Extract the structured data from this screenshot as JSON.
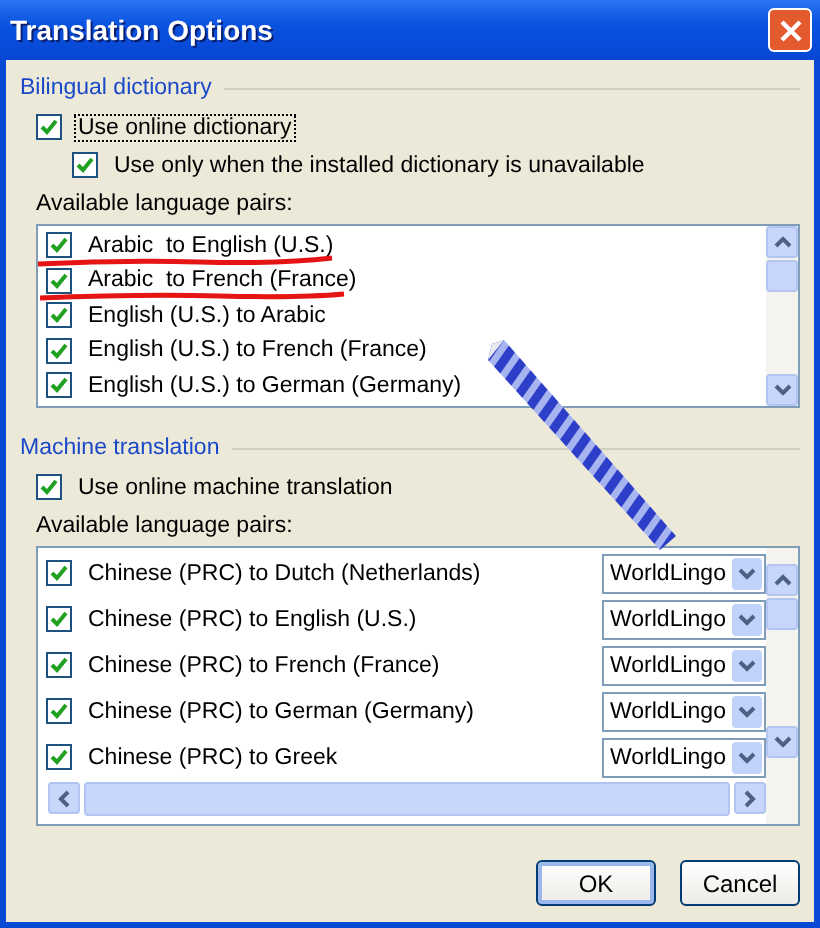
{
  "window": {
    "title": "Translation Options"
  },
  "bilingual_dictionary": {
    "heading": "Bilingual dictionary",
    "options": [
      {
        "label": "Use online dictionary",
        "checked": true,
        "focused": true,
        "indented": false
      },
      {
        "label": "Use only when the installed dictionary is unavailable",
        "checked": true,
        "focused": false,
        "indented": true
      }
    ],
    "pairs_label": "Available language pairs:",
    "pairs": [
      {
        "label": "Arabic  to English (U.S.)",
        "checked": true
      },
      {
        "label": "Arabic  to French (France)",
        "checked": true
      },
      {
        "label": "English (U.S.) to Arabic",
        "checked": true
      },
      {
        "label": "English (U.S.) to French (France)",
        "checked": true
      },
      {
        "label": "English (U.S.) to German (Germany)",
        "checked": true
      }
    ]
  },
  "machine_translation": {
    "heading": "Machine translation",
    "option": {
      "label": "Use online machine translation",
      "checked": true
    },
    "pairs_label": "Available language pairs:",
    "pairs": [
      {
        "label": "Chinese (PRC) to Dutch (Netherlands)",
        "checked": true,
        "service": "WorldLingo"
      },
      {
        "label": "Chinese (PRC) to English (U.S.)",
        "checked": true,
        "service": "WorldLingo"
      },
      {
        "label": "Chinese (PRC) to French (France)",
        "checked": true,
        "service": "WorldLingo"
      },
      {
        "label": "Chinese (PRC) to German (Germany)",
        "checked": true,
        "service": "WorldLingo"
      },
      {
        "label": "Chinese (PRC) to Greek",
        "checked": true,
        "service": "WorldLingo"
      }
    ]
  },
  "buttons": [
    {
      "label": "OK",
      "default": true
    },
    {
      "label": "Cancel",
      "default": false
    }
  ]
}
